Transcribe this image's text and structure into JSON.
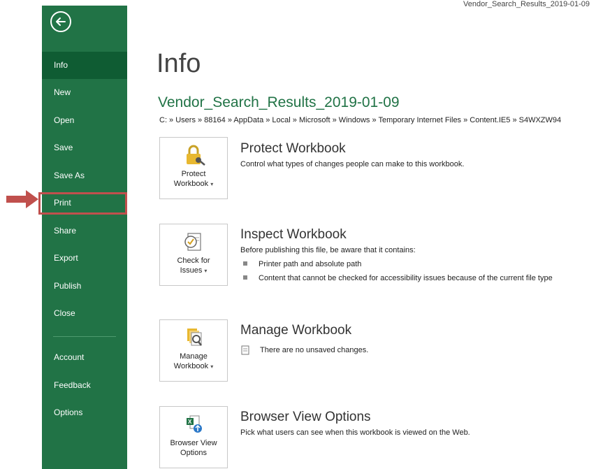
{
  "top_filename": "Vendor_Search_Results_2019-01-09",
  "sidebar": {
    "items": [
      {
        "label": "Info"
      },
      {
        "label": "New"
      },
      {
        "label": "Open"
      },
      {
        "label": "Save"
      },
      {
        "label": "Save As"
      },
      {
        "label": "Print"
      },
      {
        "label": "Share"
      },
      {
        "label": "Export"
      },
      {
        "label": "Publish"
      },
      {
        "label": "Close"
      },
      {
        "label": "Account"
      },
      {
        "label": "Feedback"
      },
      {
        "label": "Options"
      }
    ],
    "active": "Info",
    "highlighted": "Print"
  },
  "main": {
    "page_title": "Info",
    "doc_title": "Vendor_Search_Results_2019-01-09",
    "path": "C: » Users » 88164 » AppData » Local » Microsoft » Windows » Temporary Internet Files » Content.IE5 » S4WXZW94",
    "sections": [
      {
        "button_line1": "Protect",
        "button_line2": "Workbook",
        "icon": "lock-key-icon",
        "title": "Protect Workbook",
        "description": "Control what types of changes people can make to this workbook."
      },
      {
        "button_line1": "Check for",
        "button_line2": "Issues",
        "icon": "check-document-icon",
        "title": "Inspect Workbook",
        "description": "Before publishing this file, be aware that it contains:",
        "bullets": [
          "Printer path and absolute path",
          "Content that cannot be checked for accessibility issues because of the current file type"
        ]
      },
      {
        "button_line1": "Manage",
        "button_line2": "Workbook",
        "icon": "manage-workbook-icon",
        "title": "Manage Workbook",
        "description": "There are no unsaved changes."
      },
      {
        "button_line1": "Browser View",
        "button_line2": "Options",
        "icon": "browser-view-icon",
        "title": "Browser View Options",
        "description": "Pick what users can see when this workbook is viewed on the Web."
      }
    ]
  },
  "colors": {
    "sidebar": "#217346",
    "sidebar_active": "#0f5c33",
    "accent_text": "#217346",
    "highlight_border": "#c0504d",
    "arrow": "#c0504d"
  }
}
